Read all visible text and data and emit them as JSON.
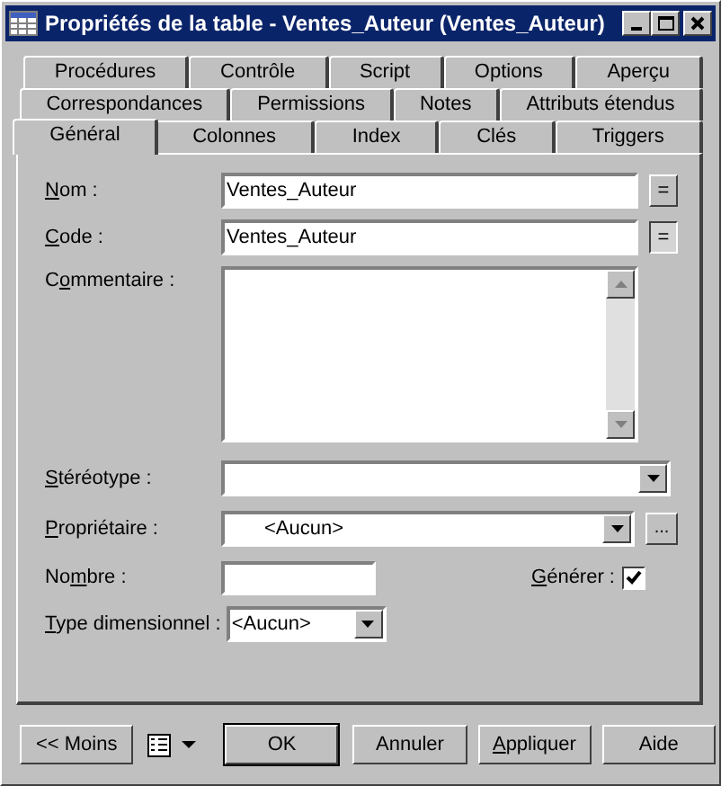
{
  "window": {
    "title": "Propriétés de la table - Ventes_Auteur (Ventes_Auteur)"
  },
  "tab_rows": [
    [
      {
        "label": "Procédures",
        "selected": false
      },
      {
        "label": "Contrôle",
        "selected": false
      },
      {
        "label": "Script",
        "selected": false
      },
      {
        "label": "Options",
        "selected": false
      },
      {
        "label": "Aperçu",
        "selected": false
      }
    ],
    [
      {
        "label": "Correspondances",
        "selected": false
      },
      {
        "label": "Permissions",
        "selected": false
      },
      {
        "label": "Notes",
        "selected": false
      },
      {
        "label": "Attributs étendus",
        "selected": false
      }
    ],
    [
      {
        "label": "Général",
        "selected": true
      },
      {
        "label": "Colonnes",
        "selected": false
      },
      {
        "label": "Index",
        "selected": false
      },
      {
        "label": "Clés",
        "selected": false
      },
      {
        "label": "Triggers",
        "selected": false
      }
    ]
  ],
  "fields": {
    "name": {
      "access_key": "N",
      "label_rest": "om :",
      "value": "Ventes_Auteur",
      "button": "="
    },
    "code": {
      "access_key": "C",
      "label_rest": "ode :",
      "value": "Ventes_Auteur",
      "button": "=",
      "button_pressed": true
    },
    "comment": {
      "label_start": "C",
      "access_key": "o",
      "label_rest": "mmentaire :"
    },
    "stereotype": {
      "access_key": "S",
      "label_rest": "téréotype :"
    },
    "owner": {
      "access_key": "P",
      "label_rest": "ropriétaire :",
      "value": "<Aucun>",
      "button": "..."
    },
    "number": {
      "label_start": "No",
      "access_key": "m",
      "label_rest": "bre :"
    },
    "generate": {
      "access_key": "G",
      "label_rest": "énérer :",
      "checked": true
    },
    "dimensional_type": {
      "access_key": "T",
      "label_rest": "ype dimensionnel :",
      "value": "<Aucun>"
    }
  },
  "buttons": [
    {
      "label": "<< Moins",
      "kind": "normal"
    },
    {
      "kind": "menu"
    },
    {
      "label": "OK",
      "kind": "default"
    },
    {
      "label": "Annuler",
      "kind": "normal"
    },
    {
      "access_key": "A",
      "label_rest": "ppliquer",
      "kind": "normal"
    },
    {
      "label": "Aide",
      "kind": "normal"
    }
  ]
}
